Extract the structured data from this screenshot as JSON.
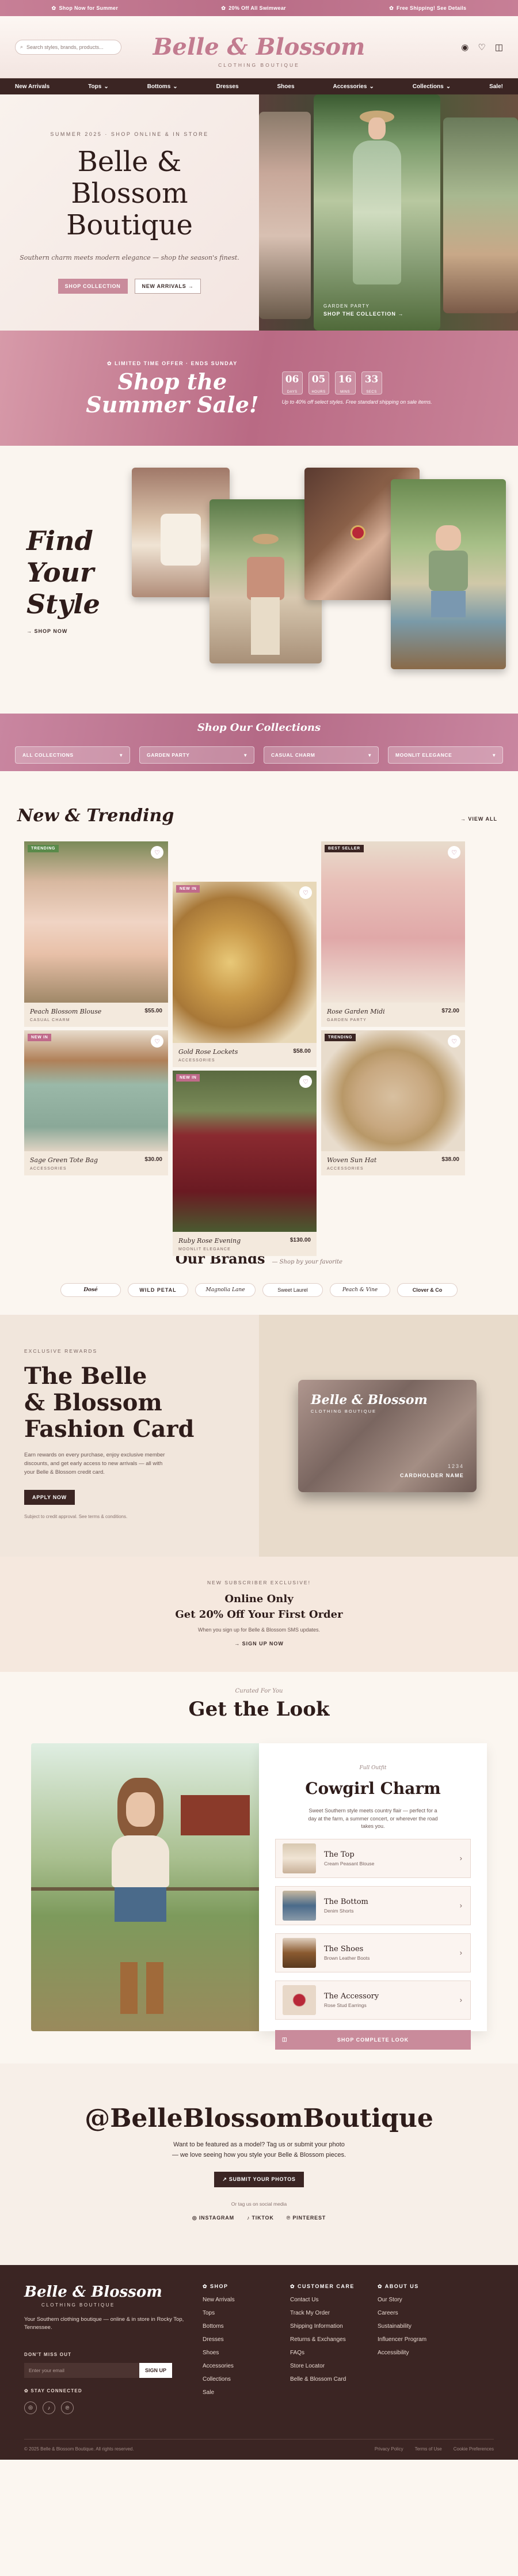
{
  "topbar": {
    "items": [
      "Shop Now for Summer",
      "20% Off All Swimwear",
      "Free Shipping! See Details"
    ]
  },
  "header": {
    "search_placeholder": "Search styles, brands, products...",
    "logo": "Belle & Blossom",
    "logo_sub": "CLOTHING BOUTIQUE"
  },
  "nav": {
    "items": [
      "New Arrivals",
      "Tops",
      "Bottoms",
      "Dresses",
      "Shoes",
      "Accessories",
      "Collections",
      "Sale!"
    ]
  },
  "hero": {
    "eyebrow": "SUMMER 2025 · SHOP ONLINE & IN STORE",
    "title_1": "Belle &",
    "title_2": "Blossom",
    "title_3": "Boutique",
    "tagline": "Southern charm meets modern elegance — shop the season's finest.",
    "btn_primary": "SHOP COLLECTION",
    "btn_secondary": "NEW ARRIVALS →",
    "cap_kicker": "GARDEN PARTY",
    "cap_link": "SHOP THE COLLECTION →"
  },
  "sale": {
    "pill": "LIMITED TIME OFFER · ENDS SUNDAY",
    "title_1": "Shop the",
    "title_2": "Summer Sale!",
    "countdown": [
      {
        "v": "06",
        "l": "DAYS"
      },
      {
        "v": "05",
        "l": "HOURS"
      },
      {
        "v": "16",
        "l": "MINS"
      },
      {
        "v": "33",
        "l": "SECS"
      }
    ],
    "note": "Up to 40% off select styles. Free standard shipping on sale items."
  },
  "find": {
    "title_1": "Find",
    "title_2": "Your",
    "title_3": "Style",
    "link": "→ SHOP NOW"
  },
  "collections": {
    "title": "Shop Our Collections",
    "tabs": [
      "ALL COLLECTIONS",
      "GARDEN PARTY",
      "CASUAL CHARM",
      "MOONLIT ELEGANCE"
    ]
  },
  "trending": {
    "title": "New & Trending",
    "view_all": "→ VIEW ALL",
    "products": [
      {
        "name": "Peach Blossom Blouse",
        "cat": "CASUAL CHARM",
        "price": "$55.00",
        "badge": "TRENDING"
      },
      {
        "name": "Gold Rose Lockets",
        "cat": "ACCESSORIES",
        "price": "$58.00",
        "badge": "NEW IN"
      },
      {
        "name": "Rose Garden Midi",
        "cat": "GARDEN PARTY",
        "price": "$72.00",
        "badge": "BEST SELLER"
      },
      {
        "name": "Sage Green Tote Bag",
        "cat": "ACCESSORIES",
        "price": "$30.00",
        "badge": "NEW IN"
      },
      {
        "name": "Ruby Rose Evening",
        "cat": "MOONLIT ELEGANCE",
        "price": "$130.00",
        "badge": "NEW IN"
      },
      {
        "name": "Woven Sun Hat",
        "cat": "ACCESSORIES",
        "price": "$38.00",
        "badge": "TRENDING"
      }
    ]
  },
  "brands": {
    "title": "Our Brands",
    "sub": "Shop by your favorite",
    "items": [
      "Dosé",
      "WILD PETAL",
      "Magnolia Lane",
      "Sweet Laurel",
      "Peach & Vine",
      "Clover & Co"
    ]
  },
  "fashion_card": {
    "kicker": "EXCLUSIVE REWARDS",
    "title_1": "The Belle",
    "title_2": "& Blossom",
    "title_3": "Fashion Card",
    "desc": "Earn rewards on every purchase, enjoy exclusive member discounts, and get early access to new arrivals — all with your Belle & Blossom credit card.",
    "btn": "APPLY NOW",
    "small": "Subject to credit approval. See terms & conditions.",
    "card_name": "Belle & Blossom",
    "card_sub": "CLOTHING BOUTIQUE",
    "card_digits": "1234",
    "card_holder": "CARDHOLDER NAME"
  },
  "newsletter": {
    "kicker": "NEW SUBSCRIBER EXCLUSIVE!",
    "h1": "Online Only",
    "h2": "Get 20% Off Your First Order",
    "p": "When you sign up for Belle & Blossom SMS updates.",
    "link": "→ SIGN UP NOW"
  },
  "look": {
    "kicker": "Curated For You",
    "title": "Get the Look",
    "panel_kicker": "Full Outfit",
    "panel_title": "Cowgirl Charm",
    "panel_desc": "Sweet Southern style meets country flair — perfect for a day at the farm, a summer concert, or wherever the road takes you.",
    "items": [
      {
        "name": "The Top",
        "desc": "Cream Peasant Blouse"
      },
      {
        "name": "The Bottom",
        "desc": "Denim Shorts"
      },
      {
        "name": "The Shoes",
        "desc": "Brown Leather Boots"
      },
      {
        "name": "The Accessory",
        "desc": "Rose Stud Earrings"
      }
    ],
    "btn": "SHOP COMPLETE LOOK"
  },
  "social": {
    "handle": "@BelleBlossomBoutique",
    "p1": "Want to be featured as a model? Tag us or submit your photo",
    "p2": "— we love seeing how you style your Belle & Blossom pieces.",
    "btn": "↗ SUBMIT YOUR PHOTOS",
    "tag": "Or tag us on social media",
    "links": [
      "INSTAGRAM",
      "TIKTOK",
      "PINTEREST"
    ]
  },
  "footer": {
    "logo": "Belle & Blossom",
    "logo_sub": "CLOTHING BOUTIQUE",
    "tagline": "Your Southern clothing boutique — online & in store in Rocky Top, Tennessee.",
    "news_label": "DON'T MISS OUT",
    "email_ph": "Enter your email",
    "signup": "SIGN UP",
    "stay": "STAY CONNECTED",
    "cols": [
      {
        "title": "SHOP",
        "links": [
          "New Arrivals",
          "Tops",
          "Bottoms",
          "Dresses",
          "Shoes",
          "Accessories",
          "Collections",
          "Sale"
        ]
      },
      {
        "title": "CUSTOMER CARE",
        "links": [
          "Contact Us",
          "Track My Order",
          "Shipping Information",
          "Returns & Exchanges",
          "FAQs",
          "Store Locator",
          "Belle & Blossom Card"
        ]
      },
      {
        "title": "ABOUT US",
        "links": [
          "Our Story",
          "Careers",
          "Sustainability",
          "Influencer Program",
          "Accessibility"
        ]
      }
    ],
    "copyright": "© 2025 Belle & Blossom Boutique. All rights reserved.",
    "legal": [
      "Privacy Policy",
      "Terms of Use",
      "Cookie Preferences"
    ]
  }
}
